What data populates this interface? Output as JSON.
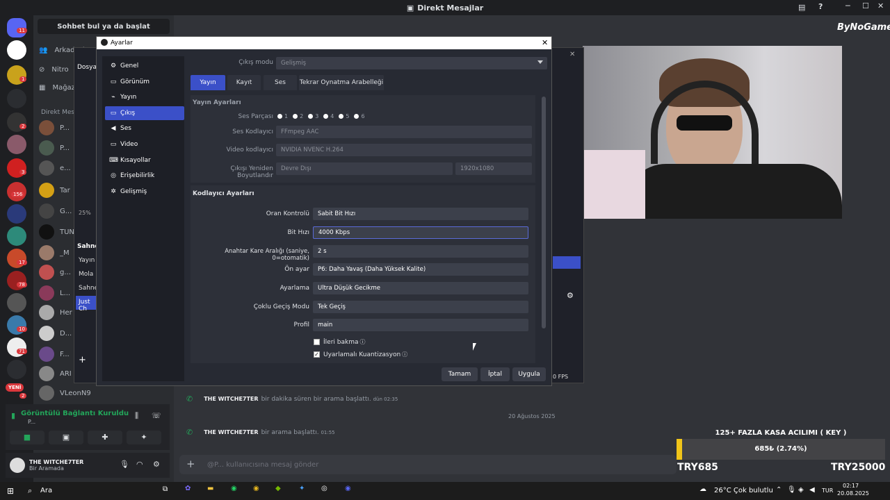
{
  "discord": {
    "title": "Direkt Mesajlar",
    "search": "Sohbet bul ya da başlat",
    "nav": [
      "Arkadaşlar",
      "Nitro",
      "Mağaza"
    ],
    "dm_header": "Direkt Mesajlar",
    "dms": [
      {
        "name": "P...",
        "color": "#7a4f3a"
      },
      {
        "name": "P...",
        "color": "#4a5b4f"
      },
      {
        "name": "e...",
        "color": "#555"
      },
      {
        "name": "Tar",
        "color": "#d4a015"
      },
      {
        "name": "G...",
        "color": "#444"
      },
      {
        "name": "TUN",
        "color": "#111"
      },
      {
        "name": "_M",
        "color": "#9a7a6a"
      },
      {
        "name": "g...",
        "color": "#c05050"
      },
      {
        "name": "L...",
        "color": "#8a3a5a"
      },
      {
        "name": "Her",
        "color": "#aaa"
      },
      {
        "name": "D...",
        "color": "#ccc"
      },
      {
        "name": "F...",
        "color": "#6a4a8a"
      },
      {
        "name": "ARI",
        "color": "#888"
      },
      {
        "name": "VLeonN9",
        "color": "#666"
      }
    ],
    "badges": [
      "11",
      "1",
      "2",
      "3",
      "156",
      "17",
      "78",
      "10",
      "71",
      "2"
    ],
    "new_label": "YENİ",
    "messages": [
      {
        "user": "THE WITCHE7TER",
        "text": "bir dakika süren bir arama başlattı.",
        "time": "dün 02:35"
      },
      {
        "user": "THE WITCHE7TER",
        "text": "bir arama başlattı.",
        "time": "01:55"
      }
    ],
    "date_divider": "20 Ağustos 2025",
    "input_placeholder": "@P... kullanıcısına mesaj gönder",
    "voice_status": "Görüntülü Bağlantı Kuruldu",
    "voice_sub": "P...",
    "user_name": "THE WITCHE7TER",
    "user_status": "Bir Aramada"
  },
  "obs_back": {
    "menu": "Dosya",
    "zoom": "25%",
    "scenes_title": "Sahne",
    "scenes": [
      "Yayın E",
      "Mola",
      "Sahne",
      "Just Ch"
    ],
    "fps": "0 FPS"
  },
  "settings": {
    "title": "Ayarlar",
    "sidebar": [
      {
        "label": "Genel",
        "icon": "⚙"
      },
      {
        "label": "Görünüm",
        "icon": "▭"
      },
      {
        "label": "Yayın",
        "icon": "⌁"
      },
      {
        "label": "Çıkış",
        "icon": "▭"
      },
      {
        "label": "Ses",
        "icon": "◀"
      },
      {
        "label": "Video",
        "icon": "▭"
      },
      {
        "label": "Kısayollar",
        "icon": "⌨"
      },
      {
        "label": "Erişebilirlik",
        "icon": "◎"
      },
      {
        "label": "Gelişmiş",
        "icon": "✲"
      }
    ],
    "output_mode_label": "Çıkış modu",
    "output_mode": "Gelişmiş",
    "tabs": [
      "Yayın",
      "Kayıt",
      "Ses",
      "Tekrar Oynatma Arabelleği"
    ],
    "stream_section": "Yayın Ayarları",
    "audio_track_label": "Ses Parçası",
    "tracks": [
      "1",
      "2",
      "3",
      "4",
      "5",
      "6"
    ],
    "audio_encoder_label": "Ses Kodlayıcı",
    "audio_encoder": "FFmpeg AAC",
    "video_encoder_label": "Video kodlayıcı",
    "video_encoder": "NVIDIA NVENC H.264",
    "rescale_label": "Çıkışı Yeniden Boyutlandır",
    "rescale": "Devre Dışı",
    "resolution": "1920x1080",
    "encoder_section": "Kodlayıcı Ayarları",
    "rate_control_label": "Oran Kontrolü",
    "rate_control": "Sabit Bit Hızı",
    "bitrate_label": "Bit Hızı",
    "bitrate": "4000 Kbps",
    "keyframe_label": "Anahtar Kare Aralığı (saniye, 0=otomatik)",
    "keyframe": "2 s",
    "preset_label": "Ön ayar",
    "preset": "P6: Daha Yavaş (Daha Yüksek Kalite)",
    "tuning_label": "Ayarlama",
    "tuning": "Ultra Düşük Gecikme",
    "multipass_label": "Çoklu Geçiş Modu",
    "multipass": "Tek Geçiş",
    "profile_label": "Profil",
    "profile": "main",
    "lookahead": "İleri bakma",
    "aq": "Uyarlamalı Kuantizasyon",
    "ok": "Tamam",
    "cancel": "İptal",
    "apply": "Uygula"
  },
  "overlay": {
    "watermark": "ByNoGame",
    "title": "125+ FAZLA KASA ACILIMI ( KEY )",
    "progress_text": "685₺ (2.74%)",
    "progress": 0.0274,
    "current": "TRY685",
    "goal": "TRY25000"
  },
  "taskbar": {
    "search": "Ara",
    "weather": "26°C  Çok bulutlu",
    "lang": "TUR",
    "time": "02:17",
    "date": "20.08.2025"
  }
}
